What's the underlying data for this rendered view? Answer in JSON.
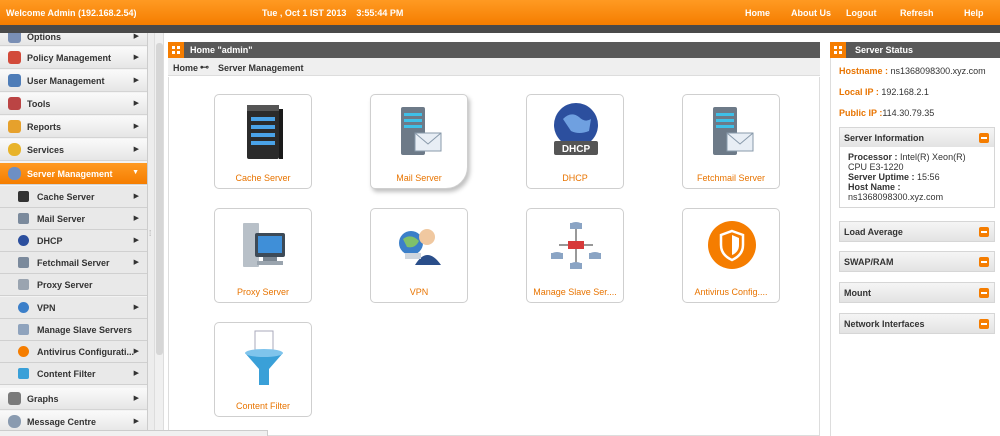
{
  "topbar": {
    "welcome": "Welcome Admin (192.168.2.54)",
    "datetime": "Tue , Oct 1 IST 2013    3:55:44 PM",
    "links": [
      "Home",
      "About Us",
      "Logout",
      "Refresh",
      "Help"
    ]
  },
  "sidebar": {
    "items": [
      {
        "label": "Options"
      },
      {
        "label": "Policy Management"
      },
      {
        "label": "User Management"
      },
      {
        "label": "Tools"
      },
      {
        "label": "Reports"
      },
      {
        "label": "Services"
      },
      {
        "label": "Server Management"
      }
    ],
    "subitems": [
      {
        "label": "Cache Server"
      },
      {
        "label": "Mail Server"
      },
      {
        "label": "DHCP"
      },
      {
        "label": "Fetchmail Server"
      },
      {
        "label": "Proxy Server"
      },
      {
        "label": "VPN"
      },
      {
        "label": "Manage Slave Servers"
      },
      {
        "label": "Antivirus Configurati..."
      },
      {
        "label": "Content Filter"
      }
    ],
    "bottom": [
      {
        "label": "Graphs"
      },
      {
        "label": "Message Centre"
      }
    ]
  },
  "main": {
    "title": "Home \"admin\"",
    "breadcrumb": {
      "home": "Home",
      "separator": "⊷",
      "current": "Server Management"
    },
    "tiles": [
      {
        "label": "Cache Server"
      },
      {
        "label": "Mail Server"
      },
      {
        "label": "DHCP"
      },
      {
        "label": "Fetchmail Server"
      },
      {
        "label": "Proxy Server"
      },
      {
        "label": "VPN"
      },
      {
        "label": "Manage Slave Ser...."
      },
      {
        "label": "Antivirus Config...."
      },
      {
        "label": "Content Filter"
      }
    ],
    "dhcp_badge": "DHCP"
  },
  "status": {
    "title": "Server Status",
    "hostname_label": "Hostname :",
    "hostname": "ns1368098300.xyz.com",
    "local_ip_label": "Local IP :",
    "local_ip": "192.168.2.1",
    "public_ip_label": "Public IP :",
    "public_ip": "114.30.79.35",
    "server_info": {
      "title": "Server Information",
      "processor_label": "Processor :",
      "processor_1": "Intel(R) Xeon(R)",
      "processor_2": "CPU E3-1220",
      "uptime_label": "Server Uptime :",
      "uptime": "15:56",
      "hostname_label": "Host Name :",
      "hostname": "ns1368098300.xyz.com"
    },
    "boxes": [
      "Load Average",
      "SWAP/RAM",
      "Mount",
      "Network Interfaces"
    ]
  },
  "colors": {
    "accent": "#f57d00",
    "header_dark": "#595959",
    "tile_label": "#e87400"
  }
}
